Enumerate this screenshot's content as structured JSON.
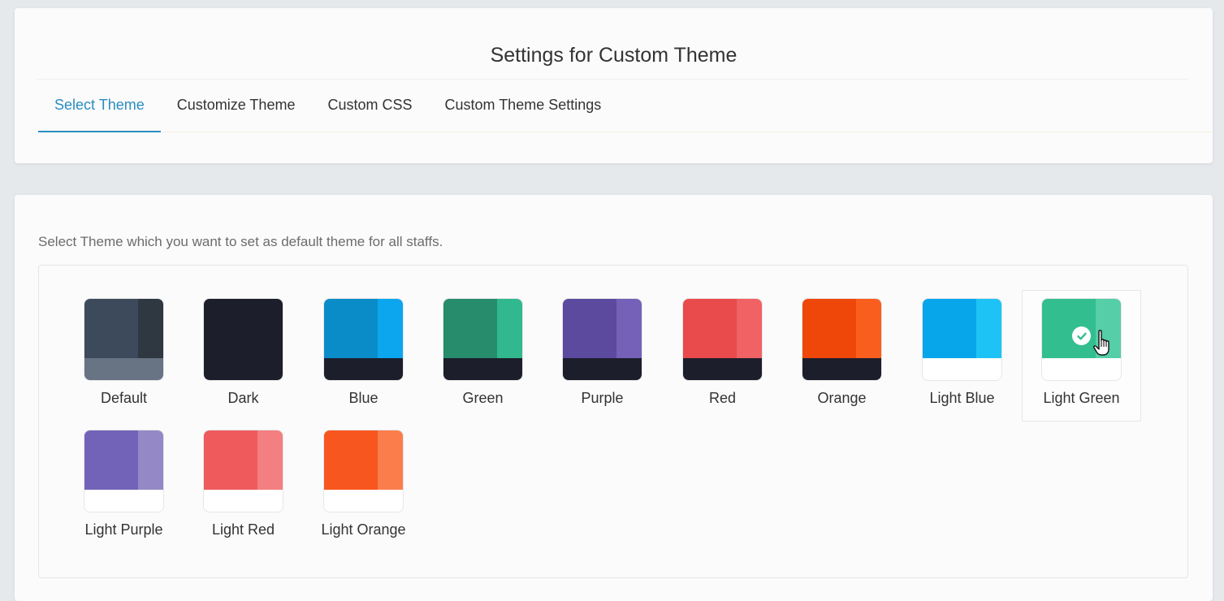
{
  "header": {
    "title": "Settings for Custom Theme",
    "tabs": [
      {
        "label": "Select Theme",
        "active": true
      },
      {
        "label": "Customize Theme",
        "active": false
      },
      {
        "label": "Custom CSS",
        "active": false
      },
      {
        "label": "Custom Theme Settings",
        "active": false
      }
    ]
  },
  "main": {
    "intro": "Select Theme which you want to set as default theme for all staffs.",
    "selected_theme": "Light Green",
    "themes": [
      {
        "label": "Default",
        "colors": {
          "main": "#3d4a5c",
          "side": "#2f3841",
          "bottom": "#687484"
        }
      },
      {
        "label": "Dark",
        "colors": {
          "main": "#1c1e2c",
          "side": "#1c1e2c",
          "bottom": "#1c1e2c"
        }
      },
      {
        "label": "Blue",
        "colors": {
          "main": "#0a8cc8",
          "side": "#0ca6ee",
          "bottom": "#1c1e2c"
        }
      },
      {
        "label": "Green",
        "colors": {
          "main": "#268c6c",
          "side": "#31b88e",
          "bottom": "#1c1e2c"
        }
      },
      {
        "label": "Purple",
        "colors": {
          "main": "#5b4a9e",
          "side": "#7561b8",
          "bottom": "#1c1e2c"
        }
      },
      {
        "label": "Red",
        "colors": {
          "main": "#e94a4b",
          "side": "#f06264",
          "bottom": "#1c1e2c"
        }
      },
      {
        "label": "Orange",
        "colors": {
          "main": "#ee4709",
          "side": "#fa5e1e",
          "bottom": "#1c1e2c"
        }
      },
      {
        "label": "Light Blue",
        "colors": {
          "main": "#07a5ea",
          "side": "#1ec3f5",
          "bottom": "#ffffff"
        }
      },
      {
        "label": "Light Green",
        "colors": {
          "main": "#33be90",
          "side": "#56cea8",
          "bottom": "#ffffff"
        }
      },
      {
        "label": "Light Purple",
        "colors": {
          "main": "#7363b8",
          "side": "#9488c7",
          "bottom": "#ffffff"
        }
      },
      {
        "label": "Light Red",
        "colors": {
          "main": "#ef5b5d",
          "side": "#f37f80",
          "bottom": "#ffffff"
        }
      },
      {
        "label": "Light Orange",
        "colors": {
          "main": "#f8561f",
          "side": "#fb7d4c",
          "bottom": "#ffffff"
        }
      }
    ]
  },
  "icons": {
    "selected": "check-circle-icon",
    "pointer": "hand-pointer-icon"
  },
  "colors": {
    "accent": "#2a8dc0",
    "text": "#333333",
    "muted": "#6c6c6c"
  }
}
